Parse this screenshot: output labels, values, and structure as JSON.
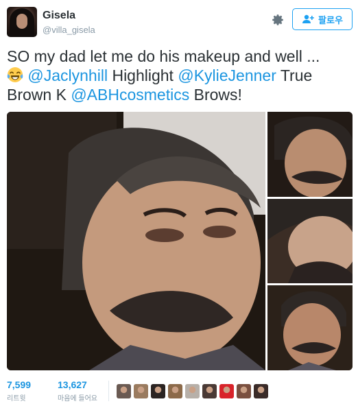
{
  "user": {
    "name": "Gisela",
    "handle": "@villa_gisela"
  },
  "actions": {
    "follow_label": "팔로우",
    "settings_icon": "gear-icon",
    "follow_icon": "add-user-icon"
  },
  "tweet": {
    "line1": "SO my dad let me do his makeup and well ...",
    "emoji": "face-with-tears-of-joy",
    "mention1": "@Jaclynhill",
    "text2": " Highlight ",
    "mention2": "@KylieJenner",
    "text3": " True Brown K ",
    "mention3": "@ABHcosmetics",
    "text4": " Brows!"
  },
  "media": {
    "photo_count": 4
  },
  "stats": {
    "retweets_count": "7,599",
    "retweets_label": "리트윗",
    "likes_count": "13,627",
    "likes_label": "마음에 들어요"
  },
  "liker_avatars": [
    {
      "color": "#6a5a52"
    },
    {
      "color": "#9a7b5f"
    },
    {
      "color": "#2b2422"
    },
    {
      "color": "#8c6a4a"
    },
    {
      "color": "#b7b0a9"
    },
    {
      "color": "#4a3a35"
    },
    {
      "color": "#d8232a"
    },
    {
      "color": "#7a5040"
    },
    {
      "color": "#3a2b28"
    }
  ],
  "colors": {
    "accent": "#1b95e0",
    "text": "#292f33",
    "muted": "#8899a6"
  }
}
